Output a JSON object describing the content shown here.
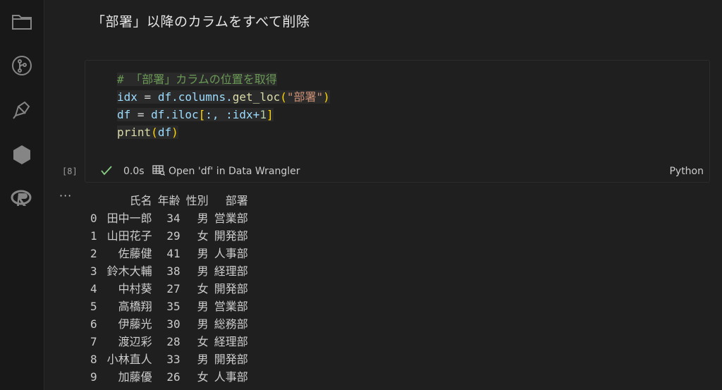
{
  "activity_bar": {
    "icons": [
      "explorer-icon",
      "source-control-icon",
      "extensions-icon",
      "hexagon-icon",
      "r-language-icon"
    ]
  },
  "markdown": {
    "heading": "「部署」以降のカラムをすべて削除"
  },
  "cell": {
    "code": {
      "line1": {
        "comment": "# 「部署」カラムの位置を取得"
      },
      "line2": {
        "var": "idx",
        "op": " = ",
        "obj": "df",
        "attr": ".columns.",
        "fn": "get_loc",
        "open": "(",
        "str": "\"部署\"",
        "close": ")"
      },
      "line3": {
        "var": "df",
        "op": " = ",
        "obj": "df",
        "attr": ".iloc",
        "open": "[",
        "args": ":, :idx+",
        "num": "1",
        "close": "]"
      },
      "line4": {
        "fn": "print",
        "open": "(",
        "arg": "df",
        "close": ")"
      }
    },
    "execution_count": "[8]",
    "status": "success",
    "exec_time": "0.0s",
    "open_wrangler_label": "Open 'df' in Data Wrangler",
    "language": "Python"
  },
  "output": {
    "menu_label": "···",
    "columns": [
      "",
      "氏名",
      "年齢",
      "性別",
      "部署"
    ],
    "rows": [
      [
        "0",
        "田中一郎",
        "34",
        "男",
        "営業部"
      ],
      [
        "1",
        "山田花子",
        "29",
        "女",
        "開発部"
      ],
      [
        "2",
        "佐藤健",
        "41",
        "男",
        "人事部"
      ],
      [
        "3",
        "鈴木大輔",
        "38",
        "男",
        "経理部"
      ],
      [
        "4",
        "中村葵",
        "27",
        "女",
        "開発部"
      ],
      [
        "5",
        "高橋翔",
        "35",
        "男",
        "営業部"
      ],
      [
        "6",
        "伊藤光",
        "30",
        "男",
        "総務部"
      ],
      [
        "7",
        "渡辺彩",
        "28",
        "女",
        "経理部"
      ],
      [
        "8",
        "小林直人",
        "33",
        "男",
        "開発部"
      ],
      [
        "9",
        "加藤優",
        "26",
        "女",
        "人事部"
      ]
    ]
  },
  "colors": {
    "background": "#1f1f1f",
    "comment": "#6a9955",
    "variable": "#9cdcfe",
    "function": "#dcdcaa",
    "string": "#ce9178",
    "success_check": "#89d185"
  }
}
